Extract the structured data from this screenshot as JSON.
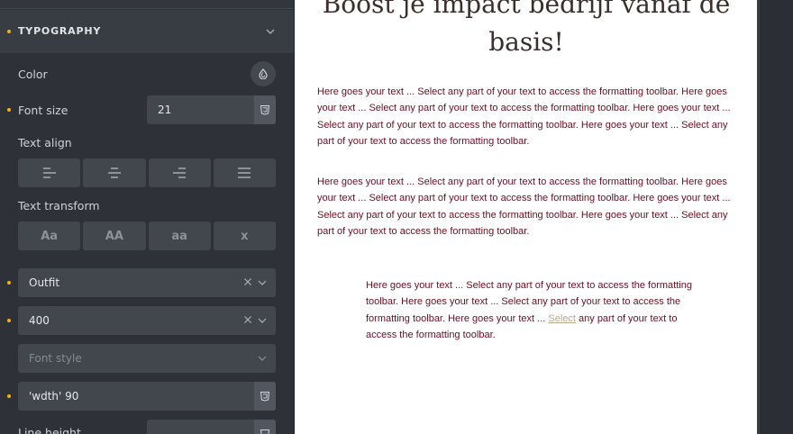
{
  "panel": {
    "section_title": "TYPOGRAPHY",
    "color_label": "Color",
    "font_size_label": "Font size",
    "font_size_value": "21",
    "text_align_label": "Text align",
    "text_transform_label": "Text transform",
    "transform_options": [
      "Aa",
      "AA",
      "aa",
      "x"
    ],
    "font_family_value": "Outfit",
    "font_weight_value": "400",
    "font_style_placeholder": "Font style",
    "font_variation_value": "'wdth' 90",
    "line_height_label": "Line height",
    "indicator_color": "#f5b400"
  },
  "canvas": {
    "heading_line1": "Boost je impact bedrijf vanaf de",
    "heading_line2": "basis!",
    "paragraph1": "Here goes your text ... Select any part of your text to access the formatting toolbar. Here goes your text ... Select any part of your text to access the formatting toolbar. Here goes your text ... Select any part of your text to access the formatting toolbar. Here goes your text ... Select any part of your text to access the formatting toolbar.",
    "paragraph2": "Here goes your text ... Select any part of your text to access the formatting toolbar. Here goes your text ... Select any part of your text to access the formatting toolbar. Here goes your text ... Select any part of your text to access the formatting toolbar. Here goes your text ... Select any part of your text to access the formatting toolbar.",
    "paragraph3_before": "Here goes your text ... Select any part of your text to access the formatting toolbar. Here goes your text ... Select any part of your text to access the formatting toolbar. Here goes your text ... ",
    "paragraph3_selected": "Select",
    "paragraph3_after": " any part of your text to access the formatting toolbar.",
    "text_color": "#6b0e22"
  }
}
